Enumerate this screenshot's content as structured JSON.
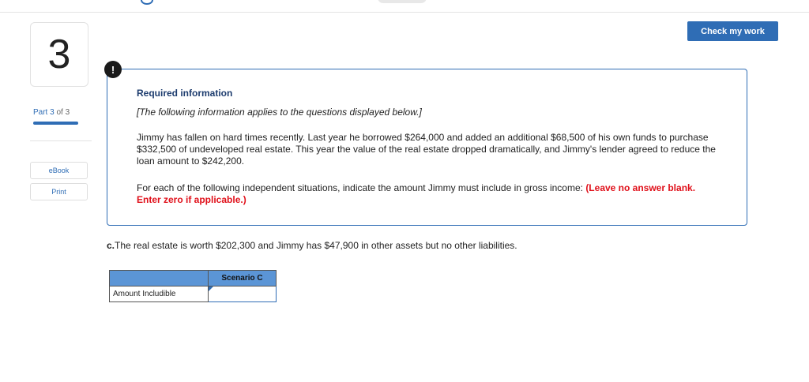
{
  "question": {
    "number": "3"
  },
  "part": {
    "prefix": "Part",
    "current": "3",
    "of": "of 3"
  },
  "sidebar": {
    "ebook_label": "eBook",
    "print_label": "Print"
  },
  "toolbar": {
    "check_label": "Check my work"
  },
  "info": {
    "icon": "!",
    "title": "Required information",
    "italic_note": "[The following information applies to the questions displayed below.]",
    "body": "Jimmy has fallen on hard times recently. Last year he borrowed $264,000 and added an additional $68,500 of his own funds to purchase $332,500 of undeveloped real estate. This year the value of the real estate dropped dramatically, and Jimmy's lender agreed to reduce the loan amount to $242,200.",
    "instruction": "For each of the following independent situations, indicate the amount Jimmy must include in gross income:",
    "instruction_red": "(Leave no answer blank. Enter zero if applicable.)"
  },
  "part_c": {
    "label": "c.",
    "text": "The real estate is worth $202,300 and Jimmy has $47,900 in other assets but no other liabilities."
  },
  "table": {
    "column_header": "Scenario C",
    "row_label": "Amount Includible",
    "value": ""
  },
  "colors": {
    "accent": "#2f6db5",
    "header_fill": "#5b95d6",
    "warning": "#e0101a"
  }
}
